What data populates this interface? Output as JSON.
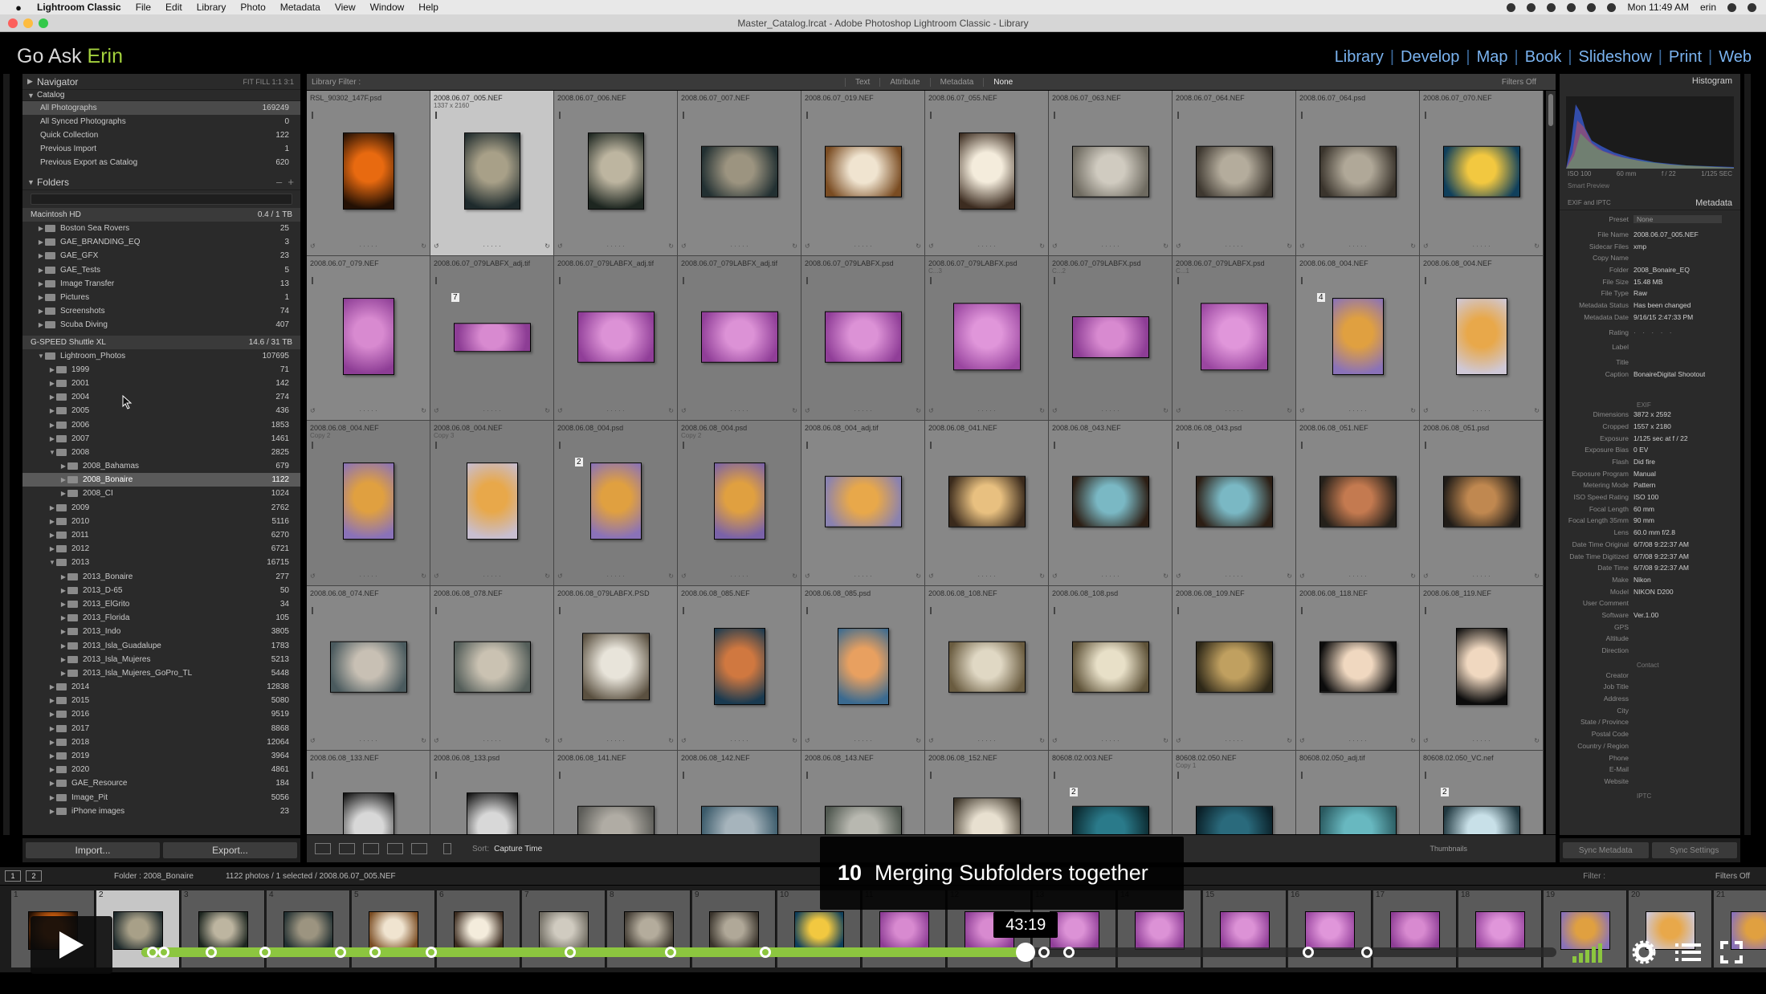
{
  "menubar": {
    "app": "Lightroom Classic",
    "items": [
      "File",
      "Edit",
      "Library",
      "Photo",
      "Metadata",
      "View",
      "Window",
      "Help"
    ],
    "clock": "Mon 11:49 AM",
    "user": "erin"
  },
  "window": {
    "title": "Master_Catalog.lrcat - Adobe Photoshop Lightroom Classic - Library"
  },
  "identity": {
    "brand_pre": "Go Ask ",
    "brand_accent": "Erin",
    "modules": [
      "Library",
      "Develop",
      "Map",
      "Book",
      "Slideshow",
      "Print",
      "Web"
    ]
  },
  "left": {
    "navigator_label": "Navigator",
    "navigator_opts": "FIT  FILL  1:1  3:1",
    "catalog_label": "Catalog",
    "catalog": [
      {
        "name": "All Photographs",
        "count": "169249"
      },
      {
        "name": "All Synced Photographs",
        "count": "0"
      },
      {
        "name": "Quick Collection",
        "count": "122"
      },
      {
        "name": "Previous Import",
        "count": "1"
      },
      {
        "name": "Previous Export as Catalog",
        "count": "620"
      }
    ],
    "folders_label": "Folders",
    "volume1": {
      "name": "Macintosh HD",
      "info": "0.4 / 1 TB"
    },
    "vol1_folders": [
      {
        "name": "Boston Sea Rovers",
        "count": "25"
      },
      {
        "name": "GAE_BRANDING_EQ",
        "count": "3"
      },
      {
        "name": "GAE_GFX",
        "count": "23"
      },
      {
        "name": "GAE_Tests",
        "count": "5"
      },
      {
        "name": "Image Transfer",
        "count": "13"
      },
      {
        "name": "Pictures",
        "count": "1"
      },
      {
        "name": "Screenshots",
        "count": "74"
      },
      {
        "name": "Scuba Diving",
        "count": "407"
      }
    ],
    "volume2": {
      "name": "G-SPEED Shuttle XL",
      "info": "14.6 / 31 TB"
    },
    "vol2_folders": [
      {
        "name": "Lightroom_Photos",
        "count": "107695",
        "level": 1,
        "open": true
      },
      {
        "name": "1999",
        "count": "71",
        "level": 2
      },
      {
        "name": "2001",
        "count": "142",
        "level": 2
      },
      {
        "name": "2004",
        "count": "274",
        "level": 2
      },
      {
        "name": "2005",
        "count": "436",
        "level": 2
      },
      {
        "name": "2006",
        "count": "1853",
        "level": 2
      },
      {
        "name": "2007",
        "count": "1461",
        "level": 2
      },
      {
        "name": "2008",
        "count": "2825",
        "level": 2,
        "open": true
      },
      {
        "name": "2008_Bahamas",
        "count": "679",
        "level": 3
      },
      {
        "name": "2008_Bonaire",
        "count": "1122",
        "level": 3,
        "selected": true
      },
      {
        "name": "2008_CI",
        "count": "1024",
        "level": 3
      },
      {
        "name": "2009",
        "count": "2762",
        "level": 2
      },
      {
        "name": "2010",
        "count": "5116",
        "level": 2
      },
      {
        "name": "2011",
        "count": "6270",
        "level": 2
      },
      {
        "name": "2012",
        "count": "6721",
        "level": 2
      },
      {
        "name": "2013",
        "count": "16715",
        "level": 2,
        "open": true
      },
      {
        "name": "2013_Bonaire",
        "count": "277",
        "level": 3
      },
      {
        "name": "2013_D-65",
        "count": "50",
        "level": 3
      },
      {
        "name": "2013_ElGrito",
        "count": "34",
        "level": 3
      },
      {
        "name": "2013_Florida",
        "count": "105",
        "level": 3
      },
      {
        "name": "2013_Indo",
        "count": "3805",
        "level": 3
      },
      {
        "name": "2013_Isla_Guadalupe",
        "count": "1783",
        "level": 3
      },
      {
        "name": "2013_Isla_Mujeres",
        "count": "5213",
        "level": 3
      },
      {
        "name": "2013_Isla_Mujeres_GoPro_TL",
        "count": "5448",
        "level": 3
      },
      {
        "name": "2014",
        "count": "12838",
        "level": 2
      },
      {
        "name": "2015",
        "count": "5080",
        "level": 2
      },
      {
        "name": "2016",
        "count": "9519",
        "level": 2
      },
      {
        "name": "2017",
        "count": "8868",
        "level": 2
      },
      {
        "name": "2018",
        "count": "12064",
        "level": 2
      },
      {
        "name": "2019",
        "count": "3964",
        "level": 2
      },
      {
        "name": "2020",
        "count": "4861",
        "level": 2
      },
      {
        "name": "GAE_Resource",
        "count": "184",
        "level": 2
      },
      {
        "name": "Image_Pit",
        "count": "5056",
        "level": 2
      },
      {
        "name": "iPhone images",
        "count": "23",
        "level": 2
      }
    ],
    "import_label": "Import...",
    "export_label": "Export..."
  },
  "filterbar": {
    "title": "Library Filter :",
    "options": [
      "Text",
      "Attribute",
      "Metadata",
      "None"
    ],
    "filters_off": "Filters Off"
  },
  "grid": {
    "cells": [
      {
        "name": "RSL_90302_147F.psd",
        "dims": "",
        "c1": "#e86a10",
        "c2": "#231004",
        "w": 64,
        "h": 96
      },
      {
        "name": "2008.06.07_005.NEF",
        "dims": "1337 x 2160",
        "c1": "#a8a088",
        "c2": "#1e2a2c",
        "w": 70,
        "h": 96,
        "sel": true
      },
      {
        "name": "2008.06.07_006.NEF",
        "dims": "",
        "c1": "#bdb5a0",
        "c2": "#1d2620",
        "w": 70,
        "h": 96
      },
      {
        "name": "2008.06.07_007.NEF",
        "dims": "",
        "c1": "#9c9480",
        "c2": "#223032",
        "w": 96,
        "h": 64
      },
      {
        "name": "2008.06.07_019.NEF",
        "dims": "",
        "c1": "#f0e4d0",
        "c2": "#7a4c22",
        "w": 96,
        "h": 64
      },
      {
        "name": "2008.06.07_055.NEF",
        "dims": "",
        "c1": "#f4ecdc",
        "c2": "#3c2c20",
        "w": 70,
        "h": 96
      },
      {
        "name": "2008.06.07_063.NEF",
        "dims": "",
        "c1": "#d0cbc0",
        "c2": "#6e6a60",
        "w": 96,
        "h": 64
      },
      {
        "name": "2008.06.07_064.NEF",
        "dims": "",
        "c1": "#b4ac9c",
        "c2": "#3e3830",
        "w": 96,
        "h": 64
      },
      {
        "name": "2008.06.07_064.psd",
        "dims": "",
        "c1": "#b0a898",
        "c2": "#3a342c",
        "w": 96,
        "h": 64
      },
      {
        "name": "2008.06.07_070.NEF",
        "dims": "",
        "c1": "#f2c840",
        "c2": "#10405c",
        "w": 96,
        "h": 64
      },
      {
        "name": "2008.06.07_079.NEF",
        "dims": "",
        "c1": "#d88ad0",
        "c2": "#8d3d95",
        "w": 64,
        "h": 96
      },
      {
        "name": "2008.06.07_079LABFX_adj.tif",
        "dims": "",
        "c1": "#d88ad0",
        "c2": "#8d3d95",
        "w": 96,
        "h": 36,
        "badge": "7",
        "stack": true
      },
      {
        "name": "2008.06.07_079LABFX_adj.tif",
        "dims": "",
        "c1": "#dc92d6",
        "c2": "#903e98",
        "w": 96,
        "h": 64,
        "stack": true
      },
      {
        "name": "2008.06.07_079LABFX_adj.tif",
        "dims": "",
        "c1": "#dc92d6",
        "c2": "#903e98",
        "w": 96,
        "h": 64,
        "stack": true
      },
      {
        "name": "2008.06.07_079LABFX.psd",
        "dims": "",
        "c1": "#dc92d6",
        "c2": "#903e98",
        "w": 96,
        "h": 64,
        "stack": true
      },
      {
        "name": "2008.06.07_079LABFX.psd",
        "dims": "C...3",
        "c1": "#e096da",
        "c2": "#9a46a0",
        "w": 84,
        "h": 84,
        "stack": true
      },
      {
        "name": "2008.06.07_079LABFX.psd",
        "dims": "C...2",
        "c1": "#d88ad0",
        "c2": "#8d3d95",
        "w": 96,
        "h": 52,
        "stack": true
      },
      {
        "name": "2008.06.07_079LABFX.psd",
        "dims": "C...1",
        "c1": "#e096da",
        "c2": "#9a46a0",
        "w": 84,
        "h": 84,
        "stack": true
      },
      {
        "name": "2008.06.08_004.NEF",
        "dims": "",
        "c1": "#e0a040",
        "c2": "#8a72b8",
        "w": 64,
        "h": 96,
        "badge": "4"
      },
      {
        "name": "2008.06.08_004.NEF",
        "dims": "",
        "c1": "#e8a84a",
        "c2": "#cfc8d6",
        "w": 64,
        "h": 96
      },
      {
        "name": "2008.06.08_004.NEF",
        "dims": "Copy 2",
        "c1": "#e0a040",
        "c2": "#8a72b8",
        "w": 64,
        "h": 96,
        "stack": true
      },
      {
        "name": "2008.06.08_004.NEF",
        "dims": "Copy 3",
        "c1": "#e8a84a",
        "c2": "#c8bed0",
        "w": 64,
        "h": 96,
        "stack": true
      },
      {
        "name": "2008.06.08_004.psd",
        "dims": "",
        "c1": "#e0a040",
        "c2": "#8a72b8",
        "w": 64,
        "h": 96,
        "badge": "2",
        "stack": true
      },
      {
        "name": "2008.06.08_004.psd",
        "dims": "Copy 2",
        "c1": "#e0a040",
        "c2": "#7a62a8",
        "w": 64,
        "h": 96,
        "stack": true
      },
      {
        "name": "2008.06.08_004_adj.tif",
        "dims": "",
        "c1": "#e8a84a",
        "c2": "#8a82b0",
        "w": 96,
        "h": 64
      },
      {
        "name": "2008.06.08_041.NEF",
        "dims": "",
        "c1": "#e8c080",
        "c2": "#3a2a1c",
        "w": 96,
        "h": 64
      },
      {
        "name": "2008.06.08_043.NEF",
        "dims": "",
        "c1": "#7ab8c4",
        "c2": "#2c1e14",
        "w": 96,
        "h": 64
      },
      {
        "name": "2008.06.08_043.psd",
        "dims": "",
        "c1": "#7ab8c4",
        "c2": "#2c1e14",
        "w": 96,
        "h": 64
      },
      {
        "name": "2008.06.08_051.NEF",
        "dims": "",
        "c1": "#c47a50",
        "c2": "#24201a",
        "w": 96,
        "h": 64
      },
      {
        "name": "2008.06.08_051.psd",
        "dims": "",
        "c1": "#c08850",
        "c2": "#201c18",
        "w": 96,
        "h": 64
      },
      {
        "name": "2008.06.08_074.NEF",
        "dims": "",
        "c1": "#c8c0b4",
        "c2": "#4a5a5e",
        "w": 96,
        "h": 64
      },
      {
        "name": "2008.06.08_078.NEF",
        "dims": "",
        "c1": "#cac2b2",
        "c2": "#545e5a",
        "w": 96,
        "h": 64
      },
      {
        "name": "2008.06.08_079LABFX.PSD",
        "dims": "",
        "c1": "#e8e4da",
        "c2": "#5a5040",
        "w": 84,
        "h": 84
      },
      {
        "name": "2008.06.08_085.NEF",
        "dims": "",
        "c1": "#d07840",
        "c2": "#1a3a50",
        "w": 64,
        "h": 96
      },
      {
        "name": "2008.06.08_085.psd",
        "dims": "",
        "c1": "#e8a060",
        "c2": "#3a6a90",
        "w": 64,
        "h": 96
      },
      {
        "name": "2008.06.08_108.NEF",
        "dims": "",
        "c1": "#e0d8c4",
        "c2": "#6a5c40",
        "w": 96,
        "h": 64
      },
      {
        "name": "2008.06.08_108.psd",
        "dims": "",
        "c1": "#e8e0c8",
        "c2": "#5e5238",
        "w": 96,
        "h": 64
      },
      {
        "name": "2008.06.08_109.NEF",
        "dims": "",
        "c1": "#c0a060",
        "c2": "#2e2818",
        "w": 96,
        "h": 64
      },
      {
        "name": "2008.06.08_118.NEF",
        "dims": "",
        "c1": "#f0d8c0",
        "c2": "#0c0c0c",
        "w": 96,
        "h": 64
      },
      {
        "name": "2008.06.08_119.NEF",
        "dims": "",
        "c1": "#f0d8c0",
        "c2": "#0c0c0c",
        "w": 64,
        "h": 96
      },
      {
        "name": "2008.06.08_133.NEF",
        "dims": "",
        "c1": "#d8d8d8",
        "c2": "#101010",
        "w": 64,
        "h": 96
      },
      {
        "name": "2008.06.08_133.psd",
        "dims": "",
        "c1": "#d8d8d8",
        "c2": "#101010",
        "w": 64,
        "h": 96
      },
      {
        "name": "2008.06.08_141.NEF",
        "dims": "",
        "c1": "#b0aca4",
        "c2": "#5c5c58",
        "w": 96,
        "h": 64
      },
      {
        "name": "2008.06.08_142.NEF",
        "dims": "",
        "c1": "#a6b4bc",
        "c2": "#3a5a6a",
        "w": 96,
        "h": 64
      },
      {
        "name": "2008.06.08_143.NEF",
        "dims": "",
        "c1": "#b8b8b0",
        "c2": "#505850",
        "w": 96,
        "h": 64
      },
      {
        "name": "2008.06.08_152.NEF",
        "dims": "",
        "c1": "#e8e0d0",
        "c2": "#3c3428",
        "w": 84,
        "h": 84
      },
      {
        "name": "80608.02.003.NEF",
        "dims": "",
        "c1": "#2a7a8a",
        "c2": "#0c2a30",
        "w": 96,
        "h": 64,
        "badge": "2"
      },
      {
        "name": "80608.02.050.NEF",
        "dims": "Copy 1",
        "c1": "#2a6a7c",
        "c2": "#0a2028",
        "w": 96,
        "h": 64
      },
      {
        "name": "80608.02.050_adj.tif",
        "dims": "",
        "c1": "#68b8c0",
        "c2": "#2a5a60",
        "w": 96,
        "h": 64
      },
      {
        "name": "80608.02.050_VC.nef",
        "dims": "",
        "c1": "#c8e0e8",
        "c2": "#203840",
        "w": 96,
        "h": 64,
        "badge": "2"
      }
    ]
  },
  "toolbar": {
    "sort_label": "Sort:",
    "sort_value": "Capture Time",
    "thumbs_label": "Thumbnails"
  },
  "right": {
    "histogram_label": "Histogram",
    "hist_info": [
      "ISO 100",
      "60 mm",
      "f / 22",
      "1/125 SEC"
    ],
    "smart_preview": "Smart Preview",
    "exif_label": "EXIF and IPTC",
    "metadata_label": "Metadata",
    "preset_label": "Preset",
    "preset_value": "None",
    "rows1": [
      {
        "l": "File Name",
        "v": "2008.06.07_005.NEF"
      },
      {
        "l": "Sidecar Files",
        "v": "xmp"
      },
      {
        "l": "Copy Name",
        "v": ""
      },
      {
        "l": "Folder",
        "v": "2008_Bonaire_EQ"
      },
      {
        "l": "File Size",
        "v": "15.48 MB"
      },
      {
        "l": "File Type",
        "v": "Raw"
      },
      {
        "l": "Metadata Status",
        "v": "Has been changed"
      },
      {
        "l": "Metadata Date",
        "v": "9/16/15 2:47:33 PM"
      }
    ],
    "rating_label": "Rating",
    "label_label": "Label",
    "title_label": "Title",
    "caption_label": "Caption",
    "caption_value": "BonaireDigital Shootout",
    "exif_section": "EXIF",
    "rows2": [
      {
        "l": "Dimensions",
        "v": "3872 x 2592"
      },
      {
        "l": "Cropped",
        "v": "1557 x 2180"
      },
      {
        "l": "Exposure",
        "v": "1/125 sec at f / 22"
      },
      {
        "l": "Exposure Bias",
        "v": "0 EV"
      },
      {
        "l": "Flash",
        "v": "Did fire"
      },
      {
        "l": "Exposure Program",
        "v": "Manual"
      },
      {
        "l": "Metering Mode",
        "v": "Pattern"
      },
      {
        "l": "ISO Speed Rating",
        "v": "ISO 100"
      },
      {
        "l": "Focal Length",
        "v": "60 mm"
      },
      {
        "l": "Focal Length 35mm",
        "v": "90 mm"
      },
      {
        "l": "Lens",
        "v": "60.0 mm f/2.8"
      },
      {
        "l": "Date Time Original",
        "v": "6/7/08 9:22:37 AM"
      },
      {
        "l": "Date Time Digitized",
        "v": "6/7/08 9:22:37 AM"
      },
      {
        "l": "Date Time",
        "v": "6/7/08 9:22:37 AM"
      },
      {
        "l": "Make",
        "v": "Nikon"
      },
      {
        "l": "Model",
        "v": "NIKON D200"
      },
      {
        "l": "User Comment",
        "v": ""
      },
      {
        "l": "Software",
        "v": "Ver.1.00"
      },
      {
        "l": "GPS",
        "v": ""
      },
      {
        "l": "Altitude",
        "v": ""
      },
      {
        "l": "Direction",
        "v": ""
      }
    ],
    "contact_section": "Contact",
    "rows3": [
      {
        "l": "Creator",
        "v": ""
      },
      {
        "l": "Job Title",
        "v": ""
      },
      {
        "l": "Address",
        "v": ""
      },
      {
        "l": "City",
        "v": ""
      },
      {
        "l": "State / Province",
        "v": ""
      },
      {
        "l": "Postal Code",
        "v": ""
      },
      {
        "l": "Country / Region",
        "v": ""
      },
      {
        "l": "Phone",
        "v": ""
      },
      {
        "l": "E-Mail",
        "v": ""
      },
      {
        "l": "Website",
        "v": ""
      }
    ],
    "iptc_section": "IPTC",
    "sync_metadata": "Sync Metadata",
    "sync_settings": "Sync Settings"
  },
  "filmstrip_bar": {
    "page1": "1",
    "page2": "2",
    "folder": "Folder : 2008_Bonaire",
    "count": "1122 photos / 1 selected / 2008.06.07_005.NEF",
    "filter_label": "Filter :",
    "filters_off": "Filters Off"
  },
  "filmstrip": [
    {
      "num": "1",
      "c1": "#e86a10",
      "c2": "#231004"
    },
    {
      "num": "2",
      "c1": "#a8a088",
      "c2": "#1e2a2c"
    },
    {
      "num": "3",
      "c1": "#bdb5a0",
      "c2": "#1d2620"
    },
    {
      "num": "4",
      "c1": "#9c9480",
      "c2": "#223032"
    },
    {
      "num": "5",
      "c1": "#f0e4d0",
      "c2": "#7a4c22"
    },
    {
      "num": "6",
      "c1": "#f4ecdc",
      "c2": "#3c2c20"
    },
    {
      "num": "7",
      "c1": "#d0cbc0",
      "c2": "#6e6a60"
    },
    {
      "num": "8",
      "c1": "#b4ac9c",
      "c2": "#3e3830"
    },
    {
      "num": "9",
      "c1": "#b0a898",
      "c2": "#3a342c"
    },
    {
      "num": "10",
      "c1": "#f2c840",
      "c2": "#10405c"
    },
    {
      "num": "11",
      "c1": "#d88ad0",
      "c2": "#8d3d95"
    },
    {
      "num": "12",
      "c1": "#d88ad0",
      "c2": "#8d3d95"
    },
    {
      "num": "13",
      "c1": "#dc92d6",
      "c2": "#903e98"
    },
    {
      "num": "14",
      "c1": "#dc92d6",
      "c2": "#903e98"
    },
    {
      "num": "15",
      "c1": "#dc92d6",
      "c2": "#903e98"
    },
    {
      "num": "16",
      "c1": "#e096da",
      "c2": "#9a46a0"
    },
    {
      "num": "17",
      "c1": "#d88ad0",
      "c2": "#8d3d95"
    },
    {
      "num": "18",
      "c1": "#e096da",
      "c2": "#9a46a0"
    },
    {
      "num": "19",
      "c1": "#e0a040",
      "c2": "#8a72b8"
    },
    {
      "num": "20",
      "c1": "#e8a84a",
      "c2": "#cfc8d6"
    },
    {
      "num": "21",
      "c1": "#e0a040",
      "c2": "#8a72b8"
    }
  ],
  "video": {
    "chapter_num": "10",
    "chapter_title": "Merging Subfolders together",
    "time": "43:19",
    "progress": 0.625,
    "chapter_marks": [
      0.0,
      0.008,
      0.042,
      0.081,
      0.135,
      0.16,
      0.2,
      0.3,
      0.372,
      0.44,
      0.625,
      0.64,
      0.658,
      0.83,
      0.872
    ],
    "played_color": "#8cc63f",
    "accent": "#a3d13d",
    "link_color": "#7ab3f0"
  }
}
